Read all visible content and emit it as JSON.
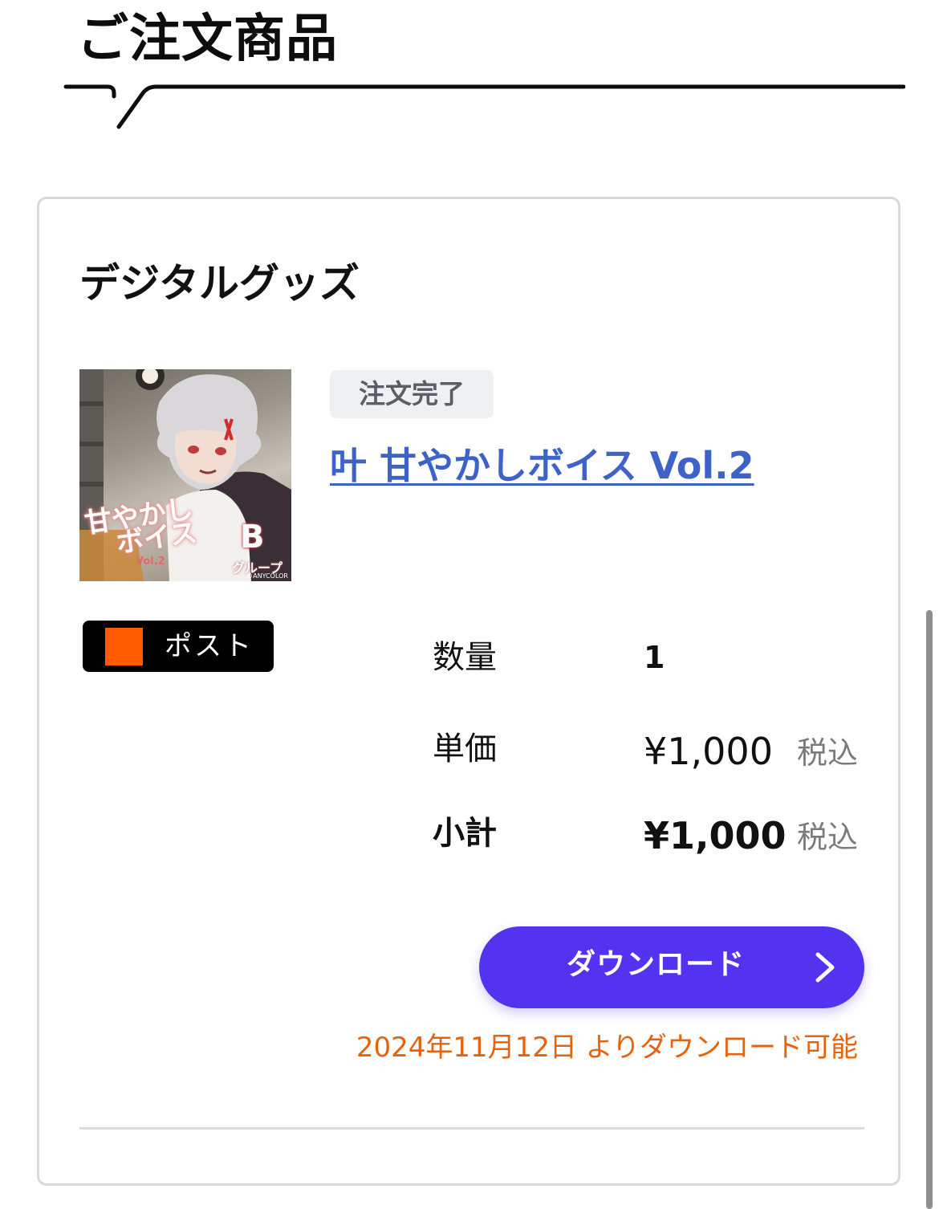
{
  "section": {
    "title": "ご注文商品"
  },
  "card": {
    "title": "デジタルグッズ",
    "item": {
      "status": "注文完了",
      "name": "叶 甘やかしボイス Vol.2",
      "thumbnail": {
        "logo_line1": "甘やかし",
        "logo_line2": "ボイス",
        "logo_sub": "Vol.2",
        "badge_letter": "B",
        "badge_group": "グループ",
        "copyright": "©ANYCOLOR"
      },
      "tag": {
        "label": "ポスト",
        "swatch_color": "#ff5a00"
      },
      "quantity": {
        "label": "数量",
        "value": "1"
      },
      "unit_price": {
        "label": "単価",
        "value": "¥1,000",
        "tax_note": "税込"
      },
      "subtotal": {
        "label": "小計",
        "value": "¥1,000",
        "tax_note": "税込"
      },
      "download": {
        "label": "ダウンロード",
        "icon": "chevron-right-icon",
        "color": "#5333f0"
      },
      "availability_note": "2024年11月12日 よりダウンロード可能",
      "availability_color": "#e8620c"
    }
  },
  "colors": {
    "link": "#3d63c9",
    "status_bg": "#eef0f2"
  }
}
